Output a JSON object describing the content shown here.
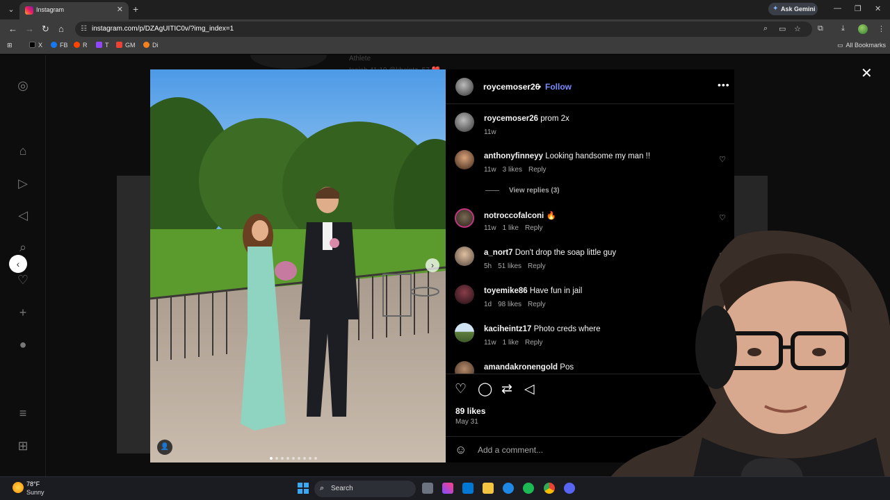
{
  "browser": {
    "tab_title": "Instagram",
    "url": "instagram.com/p/DZAgUITIC0v/?img_index=1",
    "gemini_label": "Ask Gemini",
    "bookmarks": [
      {
        "label": "X",
        "color": "#000000"
      },
      {
        "label": "FB",
        "color": "#1877f2"
      },
      {
        "label": "R",
        "color": "#ff4500"
      },
      {
        "label": "T",
        "color": "#9146ff"
      },
      {
        "label": "GM",
        "color": "#ea4335"
      },
      {
        "label": "Di",
        "color": "#f48120"
      }
    ],
    "all_bookmarks": "All Bookmarks"
  },
  "background": {
    "ghost_name": "Athlete",
    "ghost_text": "Isaiah 41:10 @kheintz_57 ❤️"
  },
  "post": {
    "username": "roycemoser26",
    "follow_label": "Follow",
    "separator": "•",
    "caption": {
      "username": "roycemoser26",
      "text": "prom 2x",
      "time": "11w"
    },
    "comments": [
      {
        "username": "anthonyfinneyy",
        "text": "Looking handsome my man !!",
        "time": "11w",
        "likes": "3 likes",
        "reply": "Reply"
      },
      {
        "username": "notroccofalconi",
        "text": "🔥",
        "time": "11w",
        "likes": "1 like",
        "reply": "Reply"
      },
      {
        "username": "a_nort7",
        "text": "Don't drop the soap little guy",
        "time": "5h",
        "likes": "51 likes",
        "reply": "Reply"
      },
      {
        "username": "toyemike86",
        "text": "Have fun in jail",
        "time": "1d",
        "likes": "98 likes",
        "reply": "Reply"
      },
      {
        "username": "kaciheintz17",
        "text": "Photo creds where",
        "time": "11w",
        "likes": "1 like",
        "reply": "Reply"
      },
      {
        "username": "amandakronengold",
        "text": "Pos",
        "time": "",
        "likes": "",
        "reply": ""
      }
    ],
    "view_replies": "View replies (3)",
    "likes": "89 likes",
    "date": "May 31",
    "comment_placeholder": "Add a comment...",
    "carousel_dots": 9,
    "active_dot": 0
  },
  "taskbar": {
    "temperature": "78°F",
    "condition": "Sunny",
    "search_label": "Search"
  },
  "colors": {
    "follow": "#7b8cff",
    "panel_bg": "#000000",
    "chrome_bg": "#3c3c3c"
  }
}
